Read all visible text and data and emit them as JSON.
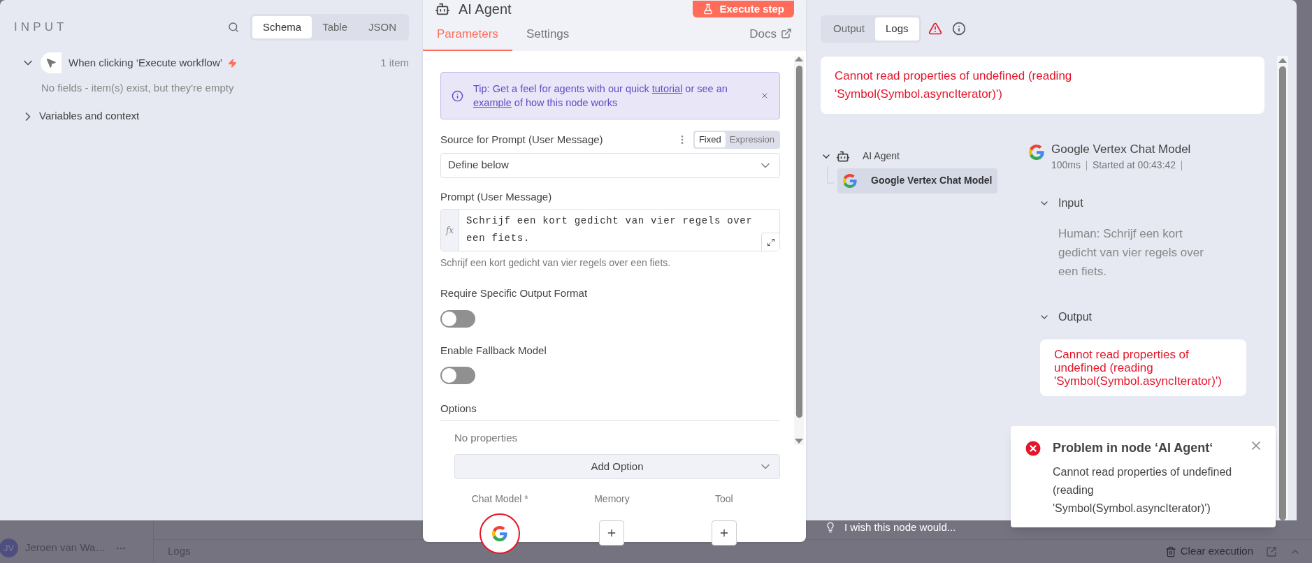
{
  "input_panel": {
    "title": "INPUT",
    "view_tabs": [
      {
        "label": "Schema",
        "selected": true
      },
      {
        "label": "Table",
        "selected": false
      },
      {
        "label": "JSON",
        "selected": false
      }
    ],
    "tree": [
      {
        "label": "When clicking ‘Execute workflow’",
        "expanded": true,
        "count": "1 item",
        "note": "No fields - item(s) exist, but they're empty"
      },
      {
        "label": "Variables and context",
        "expanded": false
      }
    ]
  },
  "node_panel": {
    "title": "AI Agent",
    "execute_button": "Execute step",
    "tabs": [
      {
        "label": "Parameters",
        "selected": true
      },
      {
        "label": "Settings",
        "selected": false
      }
    ],
    "docs_link": "Docs",
    "tip": [
      {
        "kind": "text",
        "text": "Tip: Get a feel for agents with our quick "
      },
      {
        "kind": "link",
        "text": "tutorial"
      },
      {
        "kind": "text",
        "text": " or see an "
      },
      {
        "kind": "link",
        "text": "example"
      },
      {
        "kind": "text",
        "text": " of how this node works"
      }
    ],
    "fields": [
      {
        "kind": "select",
        "label": "Source for Prompt (User Message)",
        "modes": [
          {
            "label": "Fixed",
            "selected": true
          },
          {
            "label": "Expression",
            "selected": false
          }
        ],
        "value": "Define below"
      },
      {
        "kind": "expression",
        "label": "Prompt (User Message)",
        "gutter_label": "fx",
        "value": "Schrijf een kort gedicht van vier regels over een fiets.",
        "hint": "Schrijf een kort gedicht van vier regels over een fiets."
      },
      {
        "kind": "toggle",
        "label": "Require Specific Output Format",
        "on": false
      },
      {
        "kind": "toggle",
        "label": "Enable Fallback Model",
        "on": false
      },
      {
        "kind": "options",
        "label": "Options",
        "empty_text": "No properties",
        "add_button": "Add Option"
      }
    ],
    "connectors": [
      {
        "label": "Chat Model *",
        "connected": true
      },
      {
        "label": "Memory",
        "connected": false
      },
      {
        "label": "Tool",
        "connected": false
      }
    ]
  },
  "logs_panel": {
    "tabs": [
      {
        "label": "Output",
        "selected": false
      },
      {
        "label": "Logs",
        "selected": true
      }
    ],
    "error": "Cannot read properties of undefined (reading 'Symbol(Symbol.asyncIterator)')",
    "tree": [
      {
        "label": "AI Agent",
        "kind": "agent",
        "expanded": true,
        "selected": false,
        "children": [
          {
            "label": "Google Vertex Chat Model",
            "kind": "model",
            "selected": true
          }
        ]
      }
    ],
    "detail": {
      "title": "Google Vertex Chat Model",
      "duration": "100ms",
      "started": "Started at 00:43:42",
      "sections": [
        {
          "kind": "text",
          "label": "Input",
          "expanded": true,
          "content": "Human: Schrijf een kort gedicht van vier regels over een fiets."
        },
        {
          "kind": "error",
          "label": "Output",
          "expanded": true,
          "content": "Cannot read properties of undefined (reading 'Symbol(Symbol.asyncIterator)')"
        }
      ]
    }
  },
  "toast": {
    "title": "Problem in node ‘AI Agent‘",
    "message": "Cannot read properties of undefined (reading 'Symbol(Symbol.asyncIterator)')"
  },
  "background": {
    "user": {
      "initials": "JV",
      "name": "Jeroen van Wa…"
    },
    "logs_title": "Logs",
    "clear_button": "Clear execution",
    "feedback_prompt": "I wish this node would..."
  }
}
